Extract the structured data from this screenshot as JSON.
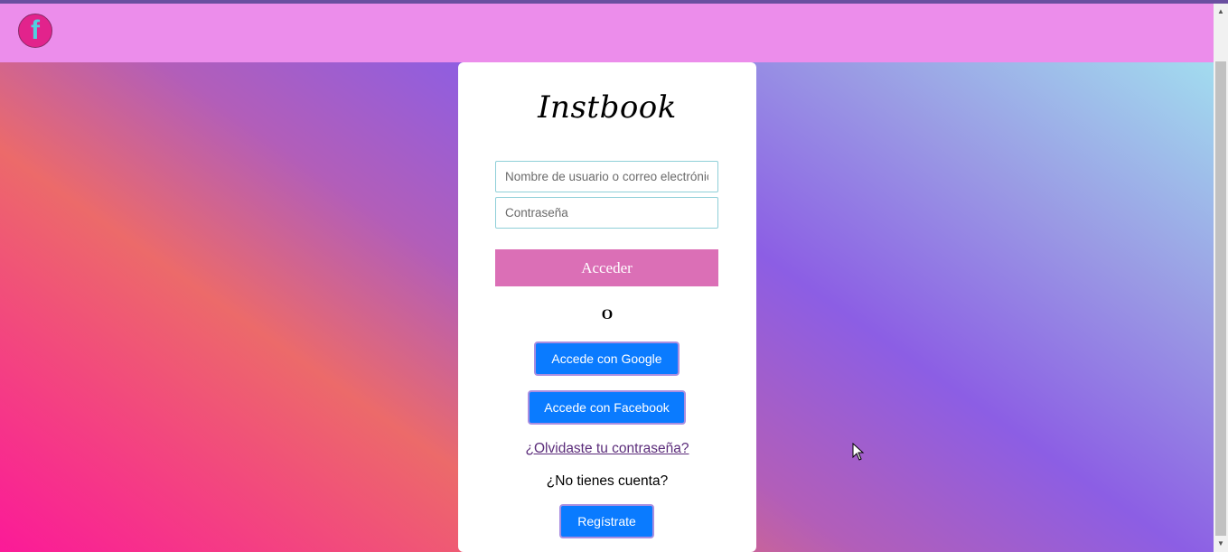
{
  "header": {
    "logo_letter": "f",
    "logo_icon": "facebook-f-icon",
    "bg_color": "#ec8deb",
    "logo_bg": "#e2238c"
  },
  "login": {
    "brand": "Instbook",
    "username_placeholder": "Nombre de usuario o correo electrónico",
    "password_placeholder": "Contraseña",
    "submit_label": "Acceder",
    "or_label": "O",
    "google_label": "Accede con Google",
    "facebook_label": "Accede con Facebook",
    "forgot_label": "¿Olvidaste tu contraseña?",
    "no_account_label": "¿No tienes cuenta?",
    "register_label": "Regístrate"
  },
  "colors": {
    "submit_bg": "#db6fb6",
    "social_bg": "#0a7bff",
    "link": "#5b2c7a"
  }
}
